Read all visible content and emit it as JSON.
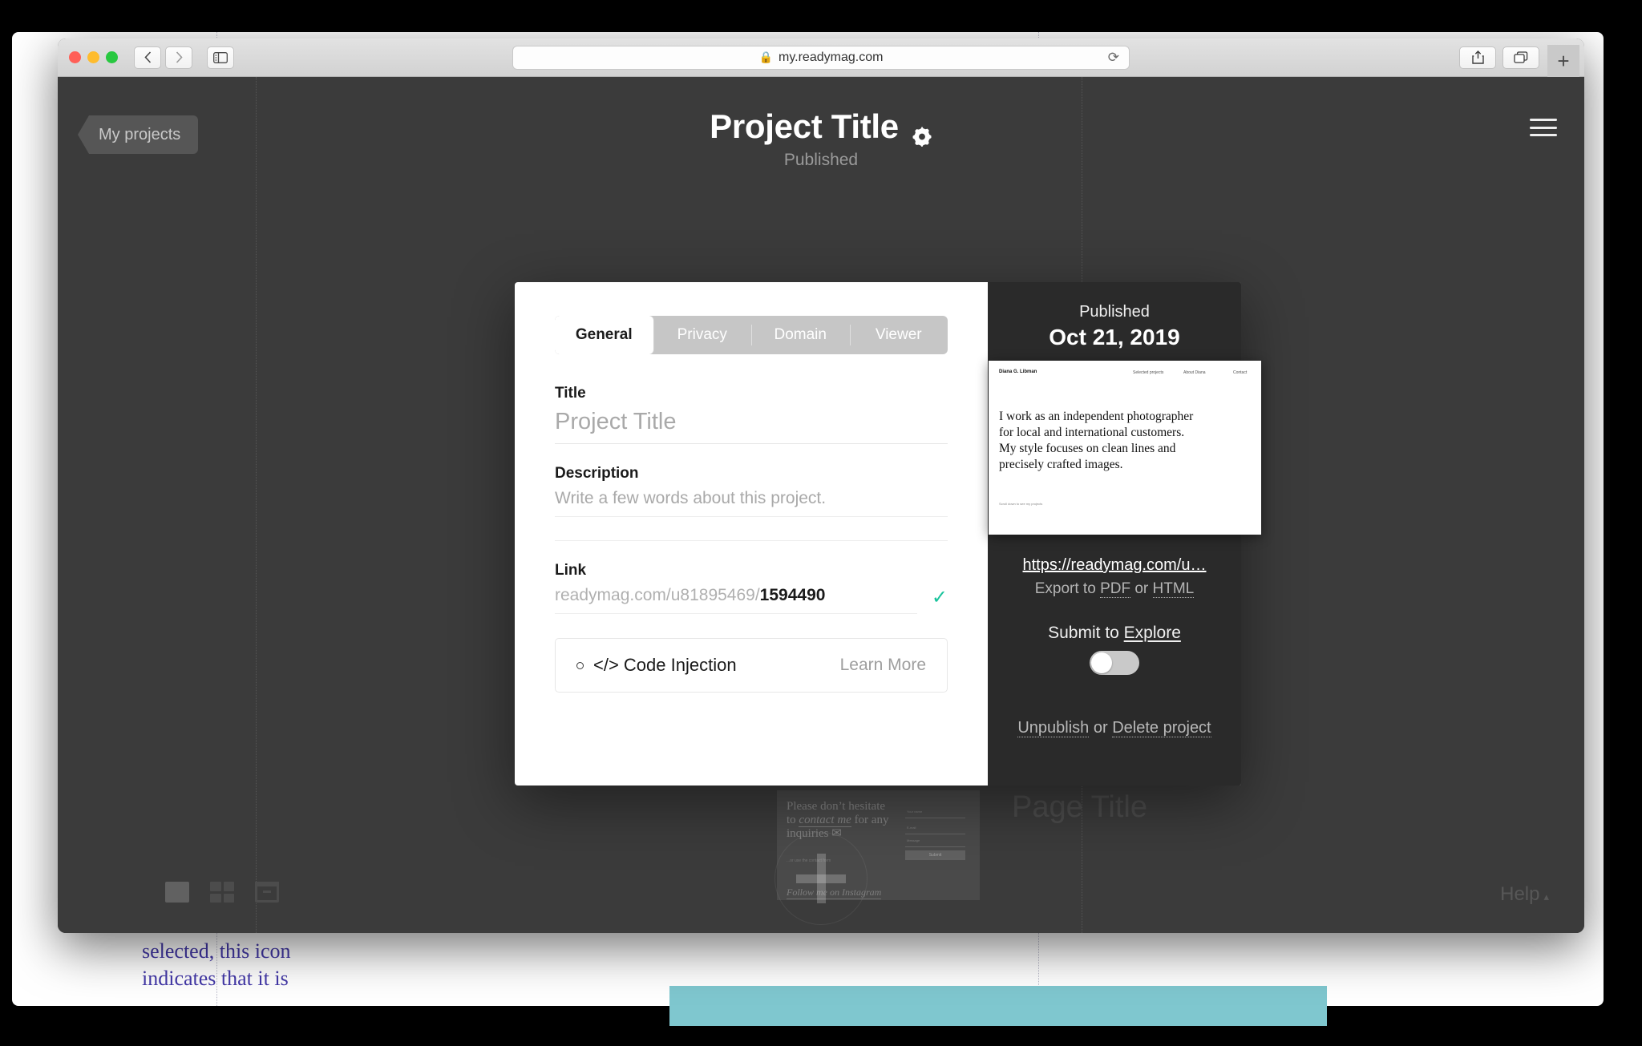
{
  "browser": {
    "url": "my.readymag.com",
    "lock_icon": "lock-icon",
    "back_icon": "chevron-left-icon",
    "forward_icon": "chevron-right-icon",
    "sidebar_icon": "sidebar-icon",
    "reload_icon": "reload-icon",
    "share_icon": "share-icon",
    "tabs_icon": "tabs-overview-icon",
    "newtab_label": "+"
  },
  "app": {
    "my_projects_label": "My projects",
    "project_title": "Project Title",
    "settings_icon": "gear-icon",
    "status": "Published",
    "menu_icon": "hamburger-menu-icon",
    "help_label": "Help",
    "help_caret": "▴",
    "view_icons": [
      "single-view-icon",
      "grid-view-icon",
      "archive-icon"
    ],
    "add_page_icon": "plus-icon",
    "ghost_page_title": "Page Title"
  },
  "background_page": {
    "headline": "Please don’t hesitate to contact me for any inquiries",
    "headline_emphasis": "contact me",
    "mail_icon": "envelope-icon",
    "subnote": "...or use the contact form",
    "instagram_label": "Follow me on Instagram",
    "form_fields": [
      "Your name",
      "E-mail",
      "Message"
    ],
    "submit_label": "Submit"
  },
  "behind_doc": {
    "text": "selected, this icon\nindicates that it is"
  },
  "modal": {
    "tabs": [
      {
        "label": "General",
        "active": true
      },
      {
        "label": "Privacy",
        "active": false
      },
      {
        "label": "Domain",
        "active": false
      },
      {
        "label": "Viewer",
        "active": false
      }
    ],
    "title_label": "Title",
    "title_placeholder": "Project Title",
    "description_label": "Description",
    "description_placeholder": "Write a few words about this project.",
    "link_label": "Link",
    "link_base": "readymag.com/u81895469/",
    "link_slug": "1594490",
    "link_valid_icon": "check-icon",
    "link_valid_color": "#19c39c",
    "code_injection_label": "</> Code Injection",
    "code_injection_status_icon": "circle-off-icon",
    "learn_more_label": "Learn More"
  },
  "panel": {
    "published_label": "Published",
    "published_date": "Oct 21, 2019",
    "preview": {
      "brand": "Diana G. Libman",
      "nav": [
        "Selected projects",
        "About Diana",
        "Contact"
      ],
      "body": "I work as an independent photographer for local and international customers. My style focuses on clean lines and precisely crafted images.",
      "footer": "Scroll down to see my projects"
    },
    "project_url": "https://readymag.com/u…",
    "export_prefix": "Export to ",
    "export_pdf": "PDF",
    "export_middle": " or ",
    "export_html": "HTML",
    "submit_prefix": "Submit to ",
    "submit_link": "Explore",
    "submit_toggle_state": "off",
    "unpublish_label": "Unpublish",
    "or_label": " or ",
    "delete_label": "Delete project"
  }
}
